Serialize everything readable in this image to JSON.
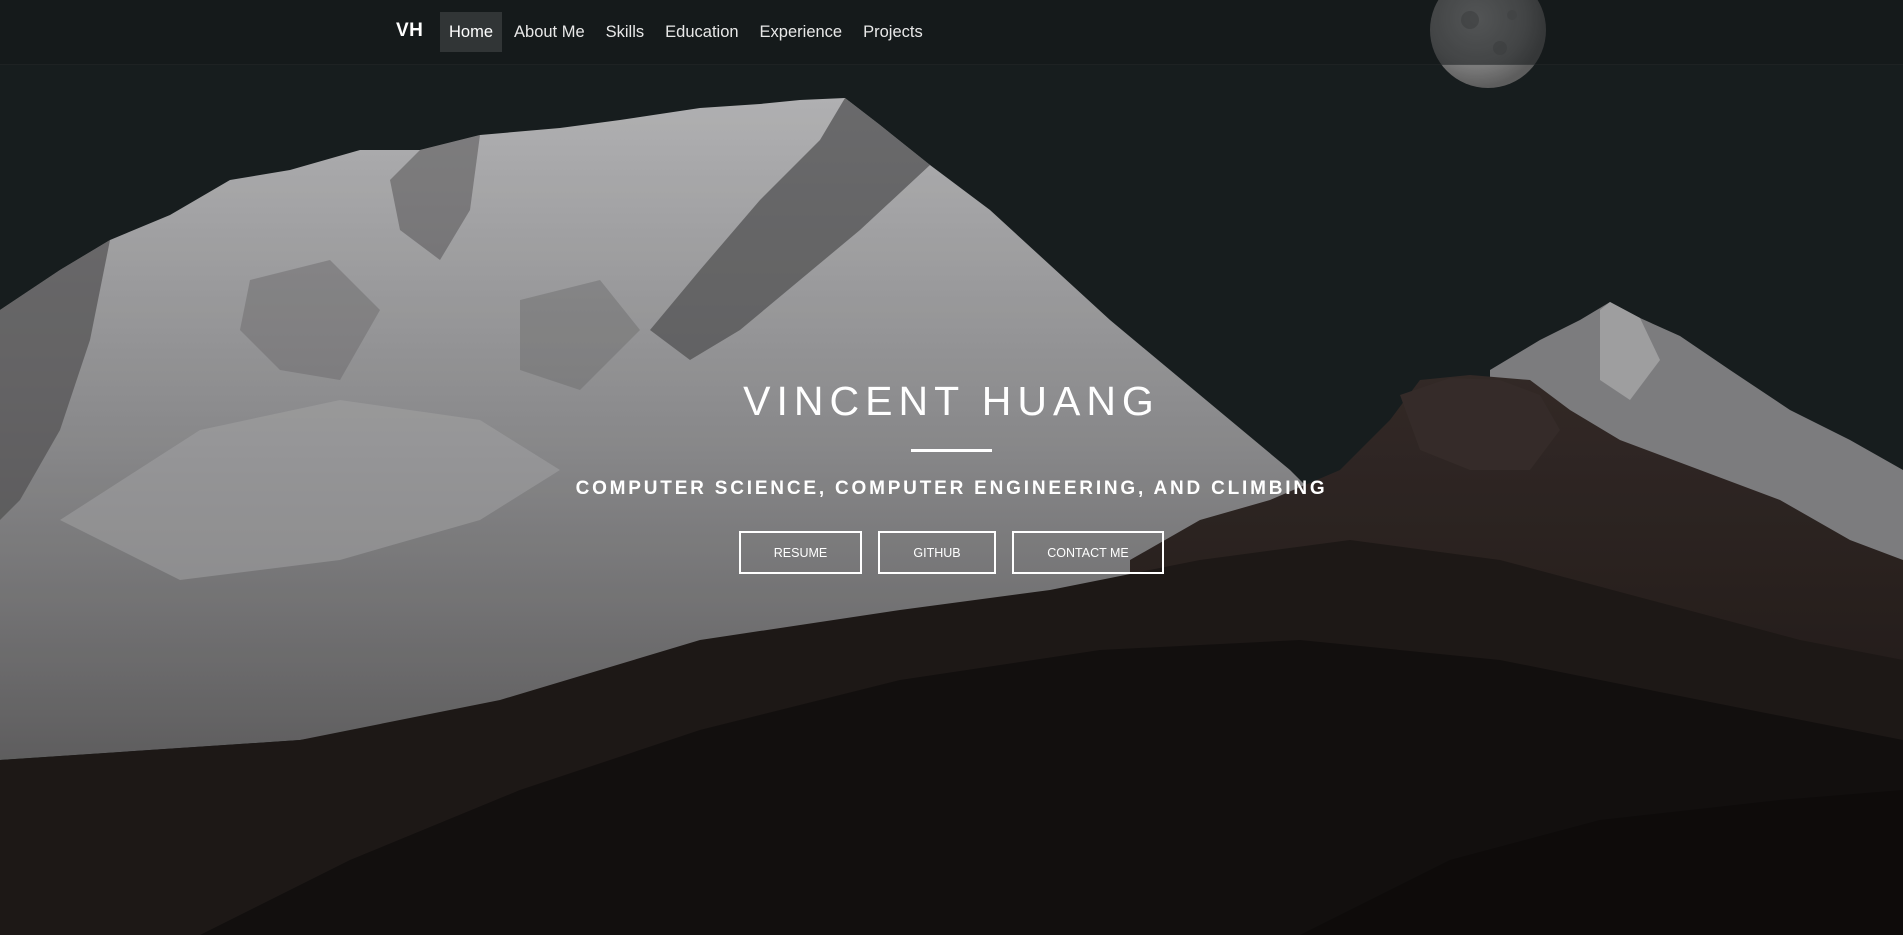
{
  "navbar": {
    "brand": "VH",
    "items": [
      {
        "label": "Home",
        "active": true
      },
      {
        "label": "About Me",
        "active": false
      },
      {
        "label": "Skills",
        "active": false
      },
      {
        "label": "Education",
        "active": false
      },
      {
        "label": "Experience",
        "active": false
      },
      {
        "label": "Projects",
        "active": false
      }
    ]
  },
  "hero": {
    "name": "VINCENT HUANG",
    "tagline": "COMPUTER SCIENCE, COMPUTER ENGINEERING, AND CLIMBING",
    "buttons": {
      "resume": "RESUME",
      "github": "GITHUB",
      "contact": "CONTACT ME"
    }
  },
  "colors": {
    "sky": "#1b2123",
    "snow": "#a9a9ab",
    "rock": "#2a2220",
    "forest": "#151211",
    "text": "#ffffff"
  },
  "icons": {
    "moon": "moon-image"
  }
}
